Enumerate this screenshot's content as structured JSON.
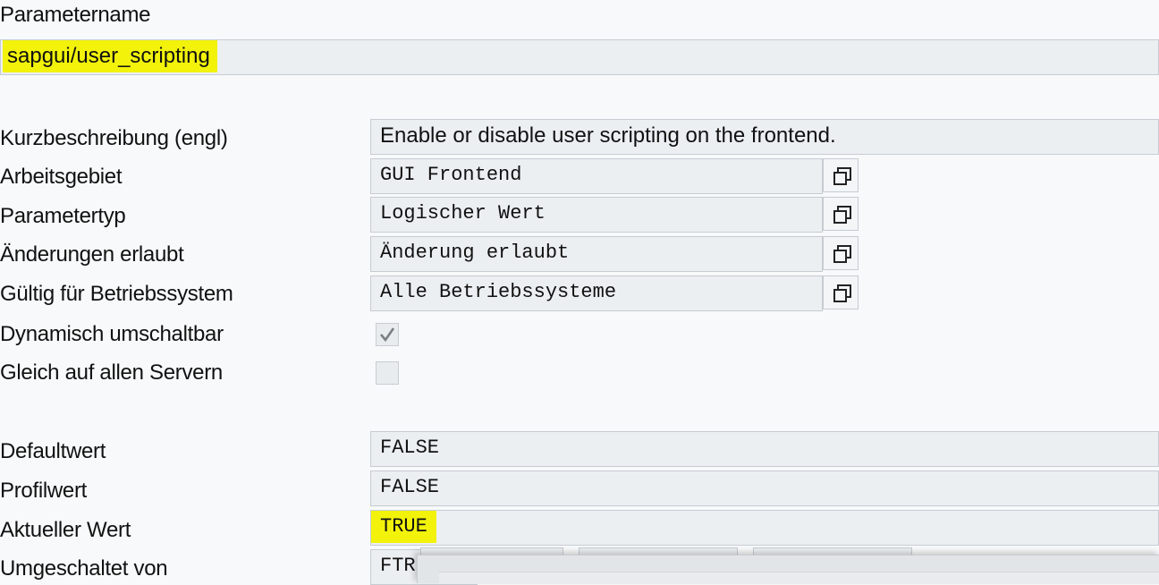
{
  "param_name": {
    "label": "Parametername",
    "value": "sapgui/user_scripting"
  },
  "fields": {
    "kurzbeschreibung": {
      "label": "Kurzbeschreibung (engl)",
      "value": "Enable or disable user scripting on the frontend."
    },
    "arbeitsgebiet": {
      "label": "Arbeitsgebiet",
      "value": "GUI Frontend"
    },
    "parametertyp": {
      "label": "Parametertyp",
      "value": "Logischer Wert"
    },
    "aenderungen": {
      "label": "Änderungen erlaubt",
      "value": "Änderung erlaubt"
    },
    "gueltig": {
      "label": "Gültig für Betriebssystem",
      "value": "Alle Betriebssysteme"
    },
    "dynamisch": {
      "label": "Dynamisch umschaltbar",
      "checked": true
    },
    "gleich": {
      "label": "Gleich auf allen Servern",
      "checked": false
    }
  },
  "values": {
    "defaultwert": {
      "label": "Defaultwert",
      "value": "FALSE"
    },
    "profilwert": {
      "label": "Profilwert",
      "value": "FALSE"
    },
    "aktueller": {
      "label": "Aktueller Wert",
      "value": "TRUE"
    },
    "umgeschaltet": {
      "label": "Umgeschaltet von",
      "value": "FTR"
    }
  },
  "icons": {
    "value_help": "value-help-icon",
    "check": "checkmark-icon"
  },
  "colors": {
    "highlight": "#f2f20b",
    "field_bg": "#eceff2",
    "page_bg": "#f7f9fa"
  }
}
